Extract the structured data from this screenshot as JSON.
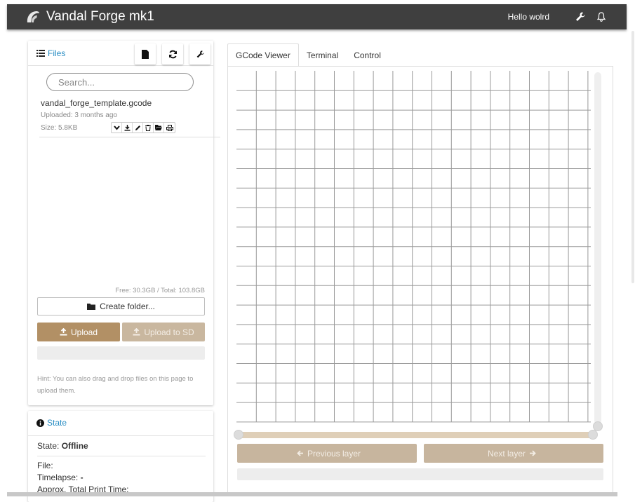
{
  "app": {
    "title": "Vandal Forge mk1",
    "greeting": "Hello wolrd"
  },
  "files": {
    "title": "Files",
    "search_placeholder": "Search...",
    "file": {
      "name": "vandal_forge_template.gcode",
      "uploaded": "Uploaded: 3 months ago",
      "size": "Size: 5.8KB"
    },
    "storage": "Free: 30.3GB / Total: 103.8GB",
    "create_folder": "Create folder...",
    "upload": "Upload",
    "upload_sd": "Upload to SD",
    "hint": "Hint: You can also drag and drop files on this page to upload them."
  },
  "state": {
    "title": "State",
    "state_label": "State:",
    "state_value": "Offline",
    "file_label": "File:",
    "timelapse_label": "Timelapse:",
    "timelapse_value": "-",
    "approx_label": "Approx. Total Print Time:"
  },
  "tabs": [
    "GCode Viewer",
    "Terminal",
    "Control"
  ],
  "viewer": {
    "prev_layer": "Previous layer",
    "next_layer": "Next layer"
  },
  "colors": {
    "navbar": "#3f3f3f",
    "link": "#2a8ec4",
    "upload": "#b29065",
    "disabled": "#c7b59e"
  }
}
